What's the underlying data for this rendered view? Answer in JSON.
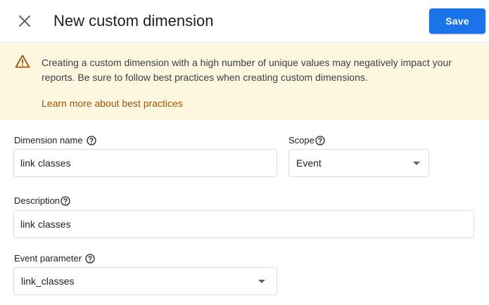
{
  "header": {
    "title": "New custom dimension",
    "save_label": "Save",
    "close_icon": "close-icon"
  },
  "banner": {
    "icon": "warning-icon",
    "message": "Creating a custom dimension with a high number of unique values may negatively impact your reports. Be sure to follow best practices when creating custom dimensions.",
    "link_text": "Learn more about best practices"
  },
  "form": {
    "dimension_name": {
      "label": "Dimension name",
      "value": "link classes",
      "help_icon": "help-icon"
    },
    "scope": {
      "label": "Scope",
      "selected": "Event",
      "help_icon": "help-icon"
    },
    "description": {
      "label": "Description",
      "value": "link classes",
      "help_icon": "help-icon"
    },
    "event_parameter": {
      "label": "Event parameter",
      "selected": "link_classes",
      "help_icon": "help-icon"
    }
  },
  "colors": {
    "primary": "#1a73e8",
    "banner_background": "#fef7e0",
    "link": "#a0520a",
    "warning_icon": "#a0520a"
  }
}
